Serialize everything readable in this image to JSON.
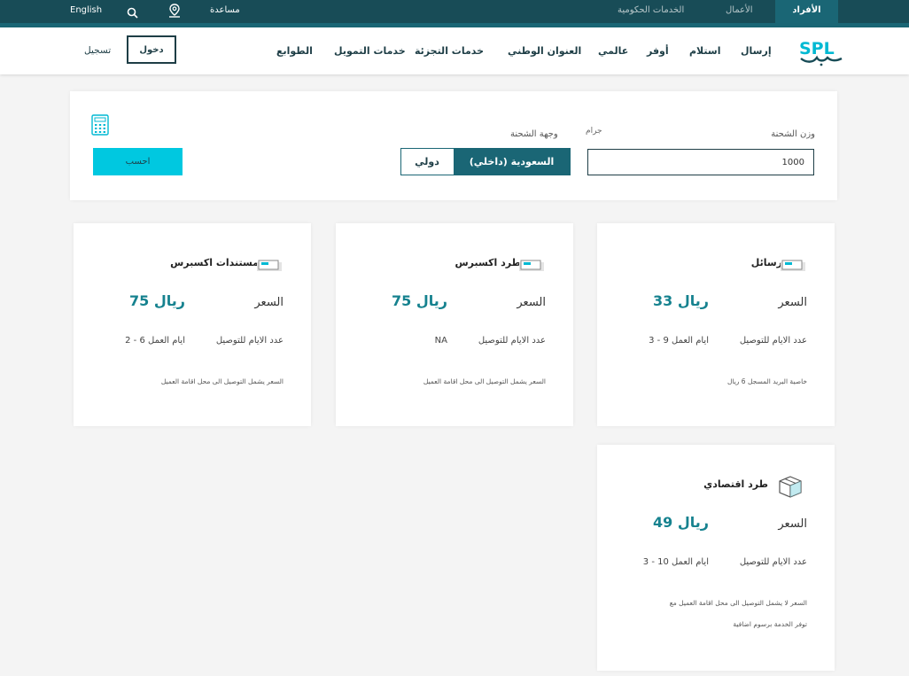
{
  "topbar": {
    "language": "English",
    "help": "مساعدة",
    "tabs": [
      "الأفراد",
      "الأعمال",
      "الخدمات الحكومية"
    ]
  },
  "nav": {
    "login": "دخول",
    "register": "تسجيل",
    "items": [
      "إرسال",
      "استلام",
      "أوفر",
      "عالمي",
      "العنوان الوطني",
      "خدمات التجزئة",
      "خدمات التمويل",
      "الطوابع"
    ]
  },
  "calculator": {
    "weight_label": "وزن الشحنة",
    "unit_label": "جرام",
    "weight_value": "1000",
    "destination_label": "وجهة الشحنة",
    "dest_domestic": "السعودية (داخلي)",
    "dest_international": "دولي",
    "calc_button": "احسب"
  },
  "cards": [
    {
      "title": "رسائل",
      "price_label": "السعر",
      "price": "33 ريال",
      "days_label": "عدد الايام للتوصيل",
      "days": "3 - 9 ايام العمل",
      "note": "خاصية البريد المسجل 6 ريال",
      "note2": ""
    },
    {
      "title": "طرد اكسبرس",
      "price_label": "السعر",
      "price": "75 ريال",
      "days_label": "عدد الايام للتوصيل",
      "days": "NA",
      "note": "السعر يشمل التوصيل الى محل اقامة العميل",
      "note2": ""
    },
    {
      "title": "مستندات اكسبرس",
      "price_label": "السعر",
      "price": "75 ريال",
      "days_label": "عدد الايام للتوصيل",
      "days": "2 - 6 ايام العمل",
      "note": "السعر يشمل التوصيل الى محل اقامة العميل",
      "note2": ""
    },
    {
      "title": "طرد اقتصادي",
      "price_label": "السعر",
      "price": "49 ريال",
      "days_label": "عدد الايام للتوصيل",
      "days": "3 - 10 ايام العمل",
      "note": "السعر لا يشمل التوصيل الى محل اقامة العميل مع",
      "note2": "توفر الخدمة برسوم اضافية"
    }
  ]
}
